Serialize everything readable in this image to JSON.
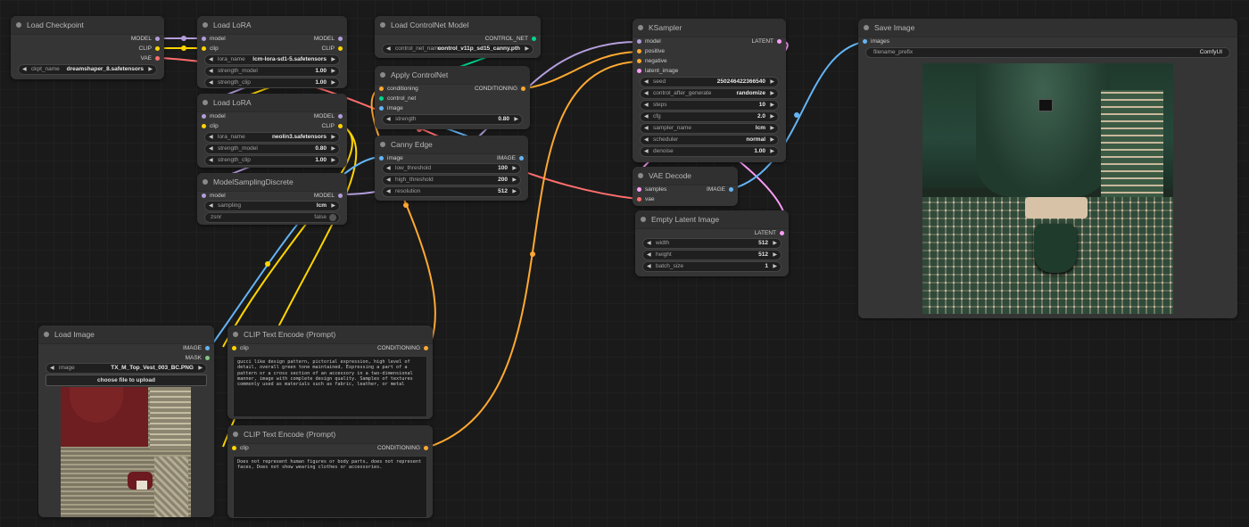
{
  "nodes": {
    "load_checkpoint": {
      "title": "Load Checkpoint",
      "outputs": [
        "MODEL",
        "CLIP",
        "VAE"
      ],
      "ckpt_name_label": "ckpt_name",
      "ckpt_name_value": "dreamshaper_8.safetensors"
    },
    "load_lora_1": {
      "title": "Load LoRA",
      "inputs": [
        "model",
        "clip"
      ],
      "outputs": [
        "MODEL",
        "CLIP"
      ],
      "lora_name_label": "lora_name",
      "lora_name_value": "lcm-lora-sd1-5.safetensors",
      "strength_model_label": "strength_model",
      "strength_model_value": "1.00",
      "strength_clip_label": "strength_clip",
      "strength_clip_value": "1.00"
    },
    "load_lora_2": {
      "title": "Load LoRA",
      "inputs": [
        "model",
        "clip"
      ],
      "outputs": [
        "MODEL",
        "CLIP"
      ],
      "lora_name_label": "lora_name",
      "lora_name_value": "neolin3.safetensors",
      "strength_model_label": "strength_model",
      "strength_model_value": "0.80",
      "strength_clip_label": "strength_clip",
      "strength_clip_value": "1.00"
    },
    "model_sampling": {
      "title": "ModelSamplingDiscrete",
      "inputs": [
        "model"
      ],
      "outputs": [
        "MODEL"
      ],
      "sampling_label": "sampling",
      "sampling_value": "lcm",
      "zsnr_label": "zsnr",
      "zsnr_value": "false"
    },
    "load_controlnet": {
      "title": "Load ControlNet Model",
      "outputs": [
        "CONTROL_NET"
      ],
      "name_label": "control_net_name",
      "name_value": "control_v11p_sd15_canny.pth"
    },
    "apply_controlnet": {
      "title": "Apply ControlNet",
      "inputs": [
        "conditioning",
        "control_net",
        "image"
      ],
      "outputs": [
        "CONDITIONING"
      ],
      "strength_label": "strength",
      "strength_value": "0.80"
    },
    "canny_edge": {
      "title": "Canny Edge",
      "inputs": [
        "image"
      ],
      "outputs": [
        "IMAGE"
      ],
      "low_label": "low_threshold",
      "low_value": "100",
      "high_label": "high_threshold",
      "high_value": "200",
      "res_label": "resolution",
      "res_value": "512"
    },
    "ksampler": {
      "title": "KSampler",
      "inputs": [
        "model",
        "positive",
        "negative",
        "latent_image"
      ],
      "outputs": [
        "LATENT"
      ],
      "widgets": [
        {
          "label": "seed",
          "value": "250246422366540"
        },
        {
          "label": "control_after_generate",
          "value": "randomize"
        },
        {
          "label": "steps",
          "value": "10"
        },
        {
          "label": "cfg",
          "value": "2.0"
        },
        {
          "label": "sampler_name",
          "value": "lcm"
        },
        {
          "label": "scheduler",
          "value": "normal"
        },
        {
          "label": "denoise",
          "value": "1.00"
        }
      ]
    },
    "vae_decode": {
      "title": "VAE Decode",
      "inputs": [
        "samples",
        "vae"
      ],
      "outputs": [
        "IMAGE"
      ]
    },
    "empty_latent": {
      "title": "Empty Latent Image",
      "outputs": [
        "LATENT"
      ],
      "widgets": [
        {
          "label": "width",
          "value": "512"
        },
        {
          "label": "height",
          "value": "512"
        },
        {
          "label": "batch_size",
          "value": "1"
        }
      ]
    },
    "save_image": {
      "title": "Save Image",
      "inputs": [
        "images"
      ],
      "prefix_label": "filename_prefix",
      "prefix_value": "ComfyUI"
    },
    "load_image": {
      "title": "Load Image",
      "outputs": [
        "IMAGE",
        "MASK"
      ],
      "image_label": "image",
      "image_value": "TX_M_Top_Vest_003_BC.PNG",
      "upload_label": "choose file to upload"
    },
    "clip_pos": {
      "title": "CLIP Text Encode (Prompt)",
      "inputs": [
        "clip"
      ],
      "outputs": [
        "CONDITIONING"
      ],
      "text": "gucci like design pattern, pictorial expression, high level of detail, overall green tone maintained, Expressing a part of a pattern or a cross section of an accessory in a two-dimensional manner, image with complete design quality. Samples of textures commonly used as materials such as fabric, leather, or metal"
    },
    "clip_neg": {
      "title": "CLIP Text Encode (Prompt)",
      "inputs": [
        "clip"
      ],
      "outputs": [
        "CONDITIONING"
      ],
      "text": "Does not represent human figures or body parts, does not represent faces, Does not show wearing clothes or accessories."
    }
  },
  "colors": {
    "model": "#b39ddb",
    "clip": "#ffd500",
    "vae": "#ff6e6e",
    "conditioning": "#ffa931",
    "control_net": "#00d78d",
    "image": "#64b5f6",
    "latent": "#ff9cf9",
    "mask": "#81c784"
  }
}
